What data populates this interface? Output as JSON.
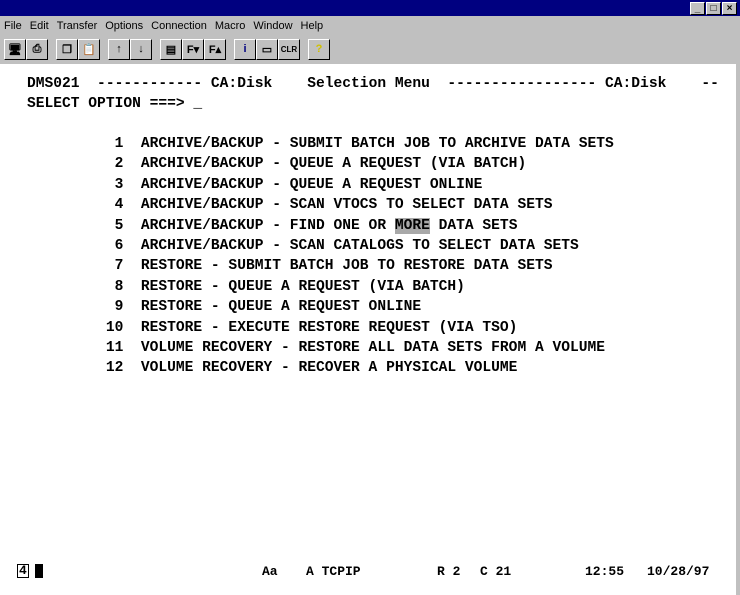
{
  "menu": [
    "File",
    "Edit",
    "Transfer",
    "Options",
    "Connection",
    "Macro",
    "Window",
    "Help"
  ],
  "toolbar": [
    "display-icon",
    "print-icon",
    "copy-icon",
    "paste-icon",
    "send-icon",
    "receive-icon",
    "printer-setup-icon",
    "font-smaller-icon",
    "font-larger-icon",
    "info-icon",
    "macro-icon",
    "clear-icon",
    "help-icon"
  ],
  "screen": {
    "header_id": "DMS021",
    "header_product": "CA:Disk",
    "header_title": "Selection Menu",
    "header_product2": "CA:Disk",
    "prompt": "SELECT OPTION ===> _",
    "options": [
      {
        "num": "1",
        "text": "ARCHIVE/BACKUP - SUBMIT BATCH JOB TO ARCHIVE DATA SETS"
      },
      {
        "num": "2",
        "text": "ARCHIVE/BACKUP - QUEUE A REQUEST (VIA BATCH)"
      },
      {
        "num": "3",
        "text": "ARCHIVE/BACKUP - QUEUE A REQUEST ONLINE"
      },
      {
        "num": "4",
        "text": "ARCHIVE/BACKUP - SCAN VTOCS TO SELECT DATA SETS"
      },
      {
        "num": "5",
        "text": "ARCHIVE/BACKUP - FIND ONE OR ",
        "hl": "MORE",
        "after": " DATA SETS"
      },
      {
        "num": "6",
        "text": "ARCHIVE/BACKUP - SCAN CATALOGS TO SELECT DATA SETS"
      },
      {
        "num": "7",
        "text": "RESTORE - SUBMIT BATCH JOB TO RESTORE DATA SETS"
      },
      {
        "num": "8",
        "text": "RESTORE - QUEUE A REQUEST (VIA BATCH)"
      },
      {
        "num": "9",
        "text": "RESTORE - QUEUE A REQUEST ONLINE"
      },
      {
        "num": "10",
        "text": "RESTORE - EXECUTE RESTORE REQUEST (VIA TSO)"
      },
      {
        "num": "11",
        "text": "VOLUME RECOVERY - RESTORE ALL DATA SETS FROM A VOLUME"
      },
      {
        "num": "12",
        "text": "VOLUME RECOVERY - RECOVER A PHYSICAL VOLUME"
      }
    ]
  },
  "status": {
    "session": "4",
    "font": "Aa",
    "conn": "A TCPIP",
    "row": "R 2",
    "col": "C 21",
    "time": "12:55",
    "date": "10/28/97"
  }
}
